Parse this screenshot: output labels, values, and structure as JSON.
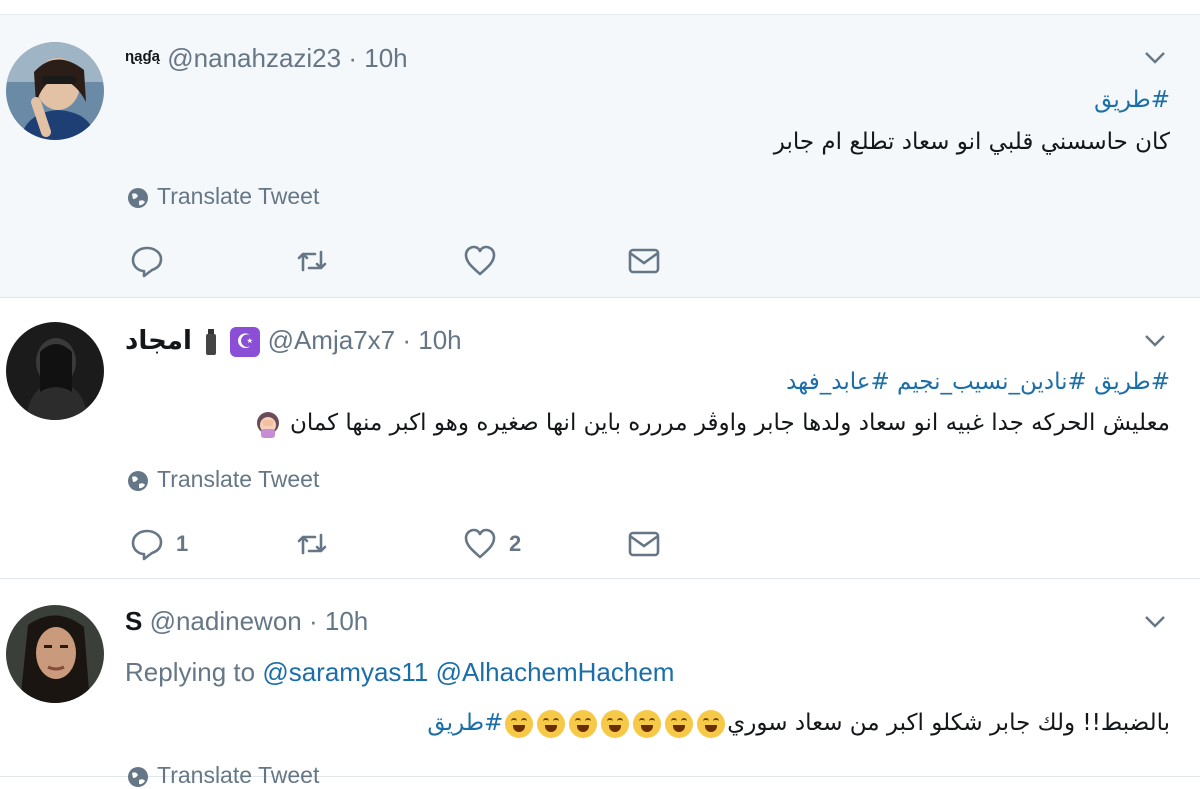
{
  "tweets": [
    {
      "name": "ɳąɠą",
      "handle": "@nanahzazi23",
      "time": "10h",
      "hashtags": "#طريق",
      "text": "كان حاسسني قلبي انو سعاد تطلع ام جابر",
      "translate": "Translate Tweet",
      "reply_count": "",
      "like_count": ""
    },
    {
      "name": "امجاد",
      "handle": "@Amja7x7",
      "time": "10h",
      "hashtags": "#طريق #نادين_نسيب_نجيم #عابد_فهد",
      "text": "معليش الحركه جدا غبيه انو سعاد ولدها جابر واوڤر مررره باين انها صغيره وهو اكبر منها كمان",
      "translate": "Translate Tweet",
      "reply_count": "1",
      "like_count": "2"
    },
    {
      "name": "S",
      "handle": "@nadinewon",
      "time": "10h",
      "replying_prefix": "Replying to",
      "replying_to_1": "@saramyas11",
      "replying_to_2": "@AlhachemHachem",
      "text": "بالضبط!! ولك جابر شكلو اكبر من سعاد سوري",
      "hashtag_end": "#طريق",
      "translate": "Translate Tweet"
    }
  ],
  "separator": "·",
  "icons": {
    "caret": "chevron-down-icon",
    "reply": "reply-icon",
    "retweet": "retweet-icon",
    "like": "heart-icon",
    "dm": "envelope-icon",
    "globe": "globe-icon",
    "emoji": "tears-of-joy-emoji"
  },
  "colors": {
    "link": "#1b6ea8",
    "muted": "#657786",
    "highlight_bg": "#f5f8fa",
    "border": "#e1e8ed"
  }
}
